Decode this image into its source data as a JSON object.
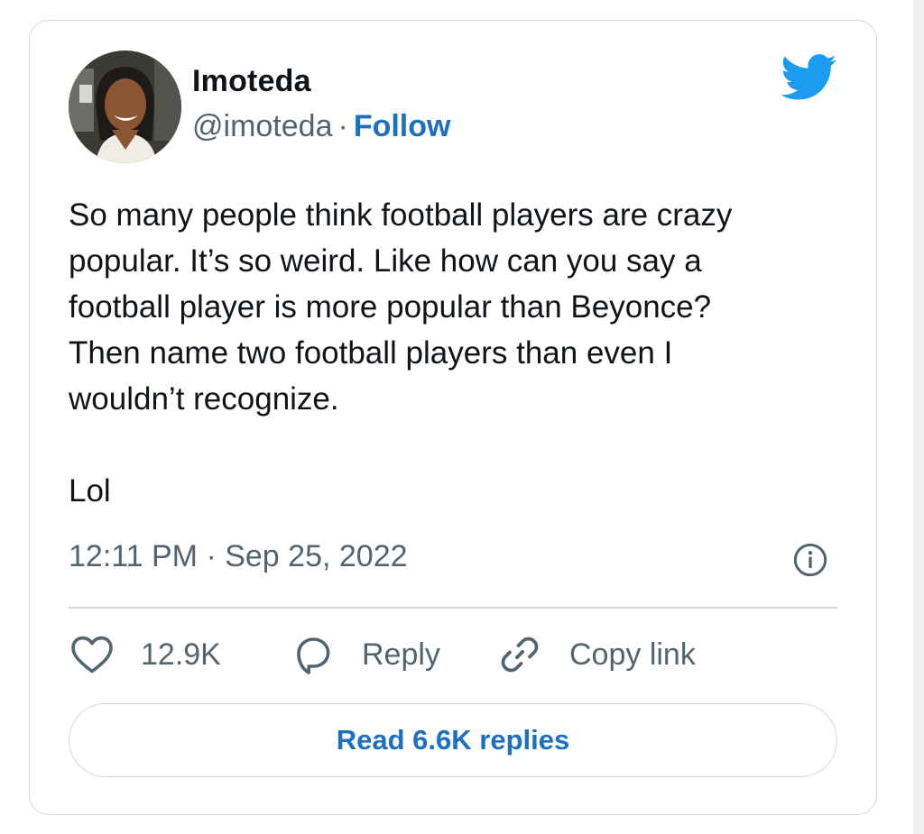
{
  "author": {
    "name": "Imoteda",
    "handle": "@imoteda",
    "separator": "·",
    "follow_label": "Follow"
  },
  "tweet": {
    "lines": [
      "So many people think football players are crazy",
      "popular. It’s so weird. Like how can you say a",
      "football player is more popular than Beyonce?",
      "Then name two football players than even I",
      "wouldn’t recognize."
    ],
    "closing": "Lol",
    "timestamp": "12:11 PM · Sep 25, 2022"
  },
  "actions": {
    "like_count": "12.9K",
    "reply_label": "Reply",
    "copy_link_label": "Copy link"
  },
  "read_replies_label": "Read 6.6K replies",
  "icons": {
    "brand": "twitter-bird-icon",
    "info": "info-icon",
    "like": "heart-icon",
    "reply": "speech-bubble-icon",
    "copy": "link-icon"
  },
  "colors": {
    "brand_blue": "#1d9bf0",
    "link_blue": "#1d6fbf",
    "secondary_text": "#536471",
    "border": "#cfd9de"
  }
}
